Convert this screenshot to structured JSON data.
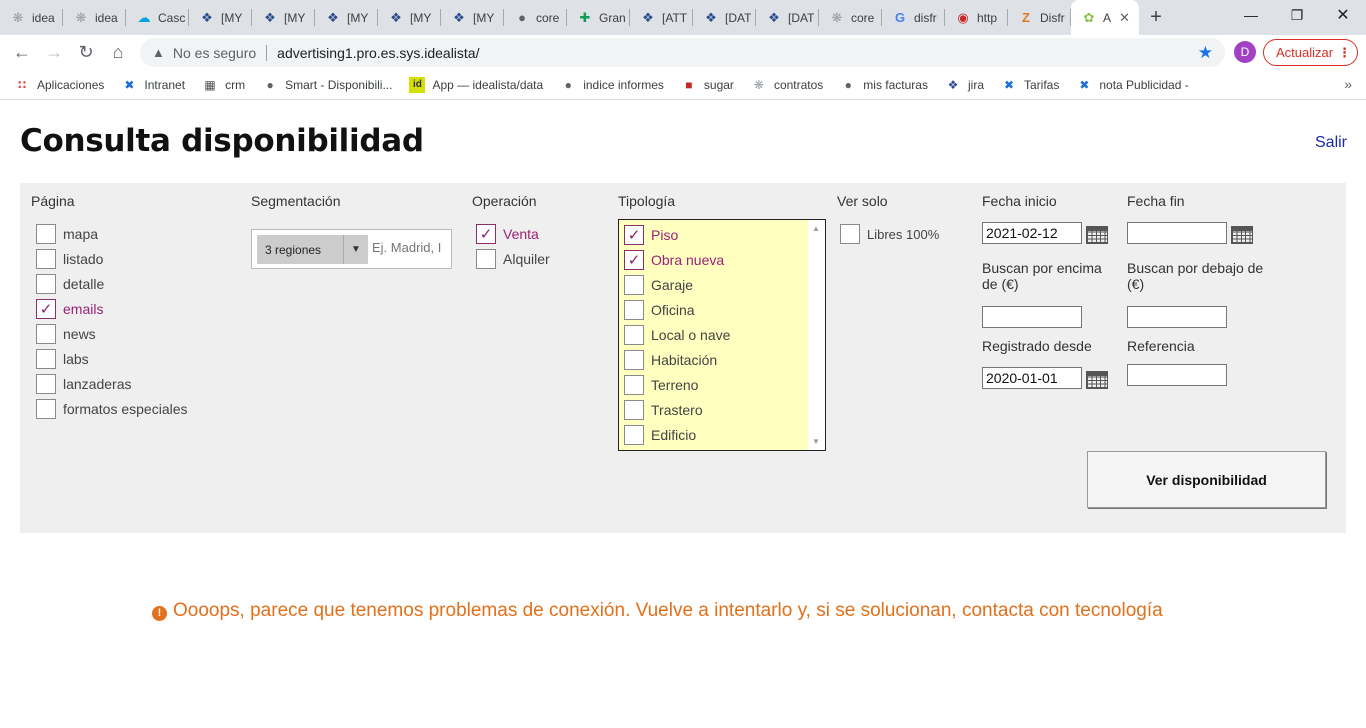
{
  "browser": {
    "tabs": [
      {
        "title": "idea",
        "icon": "puzzle-icon"
      },
      {
        "title": "idea",
        "icon": "puzzle-icon"
      },
      {
        "title": "Casc",
        "icon": "cloud-icon"
      },
      {
        "title": "[MY",
        "icon": "jira-icon"
      },
      {
        "title": "[MY",
        "icon": "jira-icon"
      },
      {
        "title": "[MY",
        "icon": "jira-icon"
      },
      {
        "title": "[MY",
        "icon": "jira-icon"
      },
      {
        "title": "[MY",
        "icon": "jira-icon"
      },
      {
        "title": "core",
        "icon": "globe-icon"
      },
      {
        "title": "Gran",
        "icon": "plus-icon"
      },
      {
        "title": "[ATT",
        "icon": "jira-icon"
      },
      {
        "title": "[DAT",
        "icon": "jira-icon"
      },
      {
        "title": "[DAT",
        "icon": "jira-icon"
      },
      {
        "title": "core",
        "icon": "puzzle-icon"
      },
      {
        "title": "disfr",
        "icon": "google-icon"
      },
      {
        "title": "http",
        "icon": "ladybug-icon"
      },
      {
        "title": "Disfr",
        "icon": "zeplin-icon"
      },
      {
        "title": "A",
        "icon": "leaf-icon",
        "active": true
      }
    ],
    "url_warning": "No es seguro",
    "url": "advertising1.pro.es.sys.idealista/",
    "profile_initial": "D",
    "update_label": "Actualizar",
    "bookmarks": [
      {
        "label": "Aplicaciones",
        "icon": "apps-icon"
      },
      {
        "label": "Intranet",
        "icon": "confluence-icon"
      },
      {
        "label": "crm",
        "icon": "crm-icon"
      },
      {
        "label": "Smart - Disponibili...",
        "icon": "globe-icon"
      },
      {
        "label": "App — idealista/data",
        "icon": "idealista-icon"
      },
      {
        "label": "indice informes",
        "icon": "globe-icon"
      },
      {
        "label": "sugar",
        "icon": "cube-icon"
      },
      {
        "label": "contratos",
        "icon": "puzzle-icon"
      },
      {
        "label": "mis facturas",
        "icon": "globe-icon"
      },
      {
        "label": "jira",
        "icon": "jira-icon"
      },
      {
        "label": "Tarifas",
        "icon": "confluence-icon"
      },
      {
        "label": "nota Publicidad -",
        "icon": "confluence-icon"
      }
    ],
    "bookmarks_more": "»"
  },
  "page": {
    "title": "Consulta disponibilidad",
    "logout": "Salir"
  },
  "filters": {
    "pagina": {
      "header": "Página",
      "options": [
        {
          "label": "mapa",
          "checked": false
        },
        {
          "label": "listado",
          "checked": false
        },
        {
          "label": "detalle",
          "checked": false
        },
        {
          "label": "emails",
          "checked": true
        },
        {
          "label": "news",
          "checked": false
        },
        {
          "label": "labs",
          "checked": false
        },
        {
          "label": "lanzaderas",
          "checked": false
        },
        {
          "label": "formatos especiales",
          "checked": false
        }
      ]
    },
    "segmentacion": {
      "header": "Segmentación",
      "selected": "3 regiones",
      "placeholder": "Ej. Madrid, I"
    },
    "operacion": {
      "header": "Operación",
      "options": [
        {
          "label": "Venta",
          "checked": true
        },
        {
          "label": "Alquiler",
          "checked": false
        }
      ]
    },
    "tipologia": {
      "header": "Tipología",
      "options": [
        {
          "label": "Piso",
          "checked": true
        },
        {
          "label": "Obra nueva",
          "checked": true
        },
        {
          "label": "Garaje",
          "checked": false
        },
        {
          "label": "Oficina",
          "checked": false
        },
        {
          "label": "Local o nave",
          "checked": false
        },
        {
          "label": "Habitación",
          "checked": false
        },
        {
          "label": "Terreno",
          "checked": false
        },
        {
          "label": "Trastero",
          "checked": false
        },
        {
          "label": "Edificio",
          "checked": false
        }
      ]
    },
    "ver_solo": {
      "header": "Ver solo",
      "option": {
        "label": "Libres 100%",
        "checked": false
      }
    },
    "fecha_inicio": {
      "label": "Fecha inicio",
      "value": "2021-02-12"
    },
    "fecha_fin": {
      "label": "Fecha fin",
      "value": ""
    },
    "buscan_encima": {
      "label": "Buscan por encima de (€)",
      "value": ""
    },
    "buscan_debajo": {
      "label": "Buscan por debajo de (€)",
      "value": ""
    },
    "registrado_desde": {
      "label": "Registrado desde",
      "value": "2020-01-01"
    },
    "referencia": {
      "label": "Referencia",
      "value": ""
    },
    "submit_label": "Ver disponibilidad"
  },
  "error_message": "Oooops, parece que tenemos problemas de conexión. Vuelve a intentarlo y, si se solucionan, contacta con tecnología",
  "colors": {
    "checked_label": "#9b2377",
    "error": "#e3701a",
    "tipologia_bg": "#ffffc0",
    "link": "#1a2aa8"
  }
}
